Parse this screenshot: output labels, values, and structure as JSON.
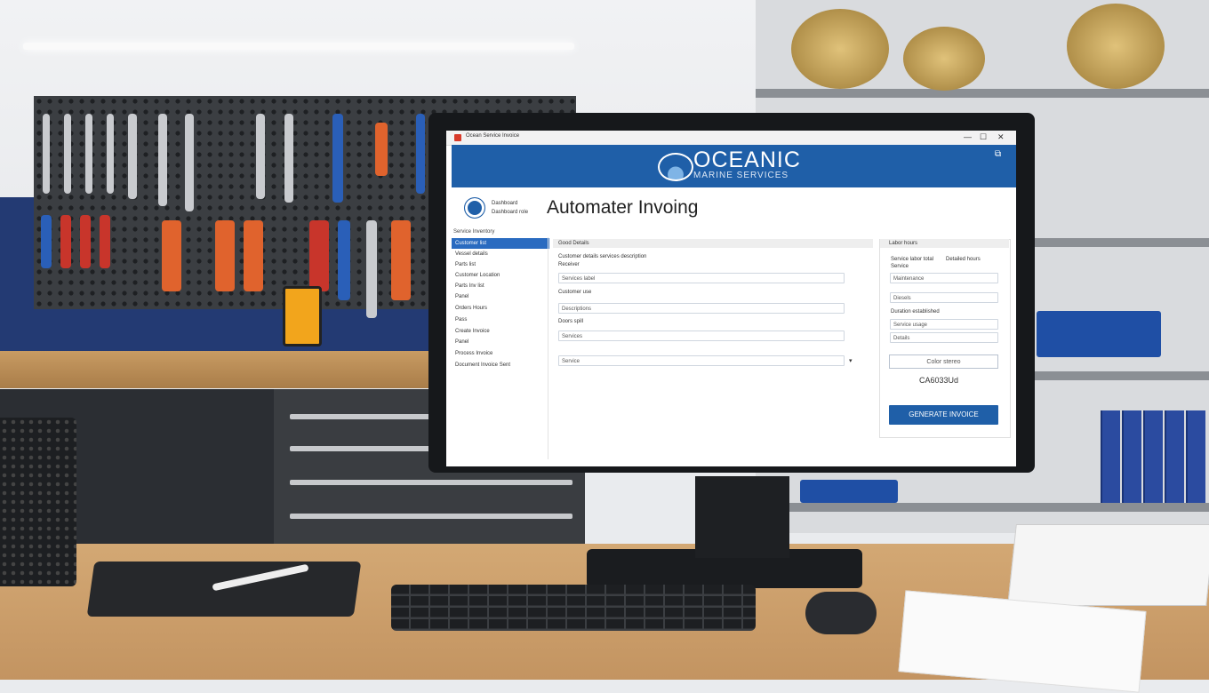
{
  "window": {
    "title": "Ocean Service Invoice",
    "controls": [
      "—",
      "☐",
      "✕"
    ]
  },
  "header": {
    "brand_main": "OCEANIC",
    "brand_sub": "MARINE SERVICES",
    "logo_icon": "wave-mountain-logo",
    "menu_icon": "window-icon"
  },
  "user": {
    "name": "Dashboard",
    "role": "Dashboard role"
  },
  "page": {
    "title": "Automater Invoing"
  },
  "sidebar": {
    "heading": "Service Inventory",
    "items": [
      {
        "label": "Customer list"
      },
      {
        "label": "Vessel details"
      },
      {
        "label": "Parts list"
      },
      {
        "label": "Customer Location"
      },
      {
        "label": "Parts Inv list"
      },
      {
        "label": "Panel"
      },
      {
        "label": "Orders Hours"
      },
      {
        "label": "Pass"
      },
      {
        "label": "Create Invoice"
      },
      {
        "label": "Panel"
      },
      {
        "label": "Process Invoice"
      },
      {
        "label": "Document Invoice Sent"
      }
    ]
  },
  "main": {
    "section_title": "Good Details",
    "label_1": "Customer details services description",
    "label_1b": "Receiver",
    "field_1": "Services label",
    "field_2": "Descriptions",
    "label_2": "Customer use",
    "field_3": "Description",
    "label_3": "Doors spill",
    "field_4": "Services",
    "select_value": "Service"
  },
  "right": {
    "section_title": "Labor hours",
    "label_a": "Service labor total",
    "label_a2": "Detailed hours",
    "label_a3": "Service",
    "field_a": "Maintenance",
    "field_b": "Diesels",
    "label_b": "Duration established",
    "field_c": "Service usage",
    "field_d": "Details",
    "btn_outline": "Color stereo",
    "code": "CA6033Ud",
    "btn_primary": "GENERATE INVOICE"
  },
  "colors": {
    "brand_blue": "#1f5fa8",
    "active_nav": "#2a6bc0"
  }
}
